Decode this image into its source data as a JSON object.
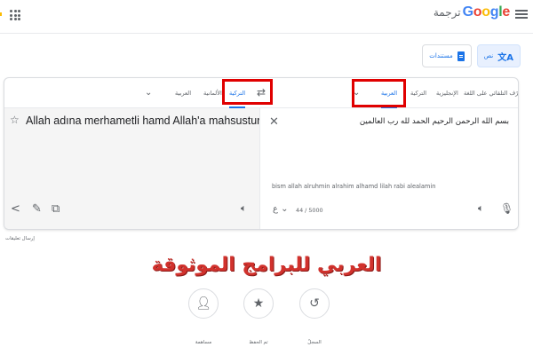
{
  "header": {
    "logo_text": "Google",
    "product_name": "ترجمة",
    "brand_colors": [
      "#4285f4",
      "#ea4335",
      "#fbbc05",
      "#4285f4",
      "#34a853",
      "#ea4335"
    ],
    "icons": {
      "menu": "hamburger-icon",
      "apps": "apps-grid-icon"
    }
  },
  "modes": [
    {
      "label": "نص",
      "icon": "translate-icon",
      "active": true
    },
    {
      "label": "مستندات",
      "icon": "document-icon",
      "active": false
    }
  ],
  "source_languages": {
    "detect": "التعرّف التلقائي على اللغة",
    "items": [
      "الإنجليزية",
      "التركية",
      "العربية"
    ],
    "selected": "العربية"
  },
  "target_languages": {
    "items": [
      "التركية",
      "الألمانية",
      "العربية"
    ],
    "selected": "التركية"
  },
  "source": {
    "text": "بسم الله الرحمن الرحيم الحمد لله رب العالمين",
    "transliteration": "bism allah alruhmin alrahim alhamd lilah rabi alealamin",
    "char_count": "44 / 5000",
    "input_tool_label": "ع"
  },
  "target": {
    "text": "Allah adına merhametli hamd Allah'a mahsustur"
  },
  "feedback_label": "إرسال تعليقات",
  "watermark": "العربي للبرامج الموثوقة",
  "bottom_buttons": [
    {
      "label": "السجلّ",
      "icon": "history-icon"
    },
    {
      "label": "تم الحفظ",
      "icon": "star-icon"
    },
    {
      "label": "مساهمة",
      "icon": "people-icon"
    }
  ],
  "colors": {
    "accent": "#1a73e8",
    "highlight_box": "#e00000",
    "watermark": "#d1322d",
    "target_bg": "#f5f5f5"
  }
}
